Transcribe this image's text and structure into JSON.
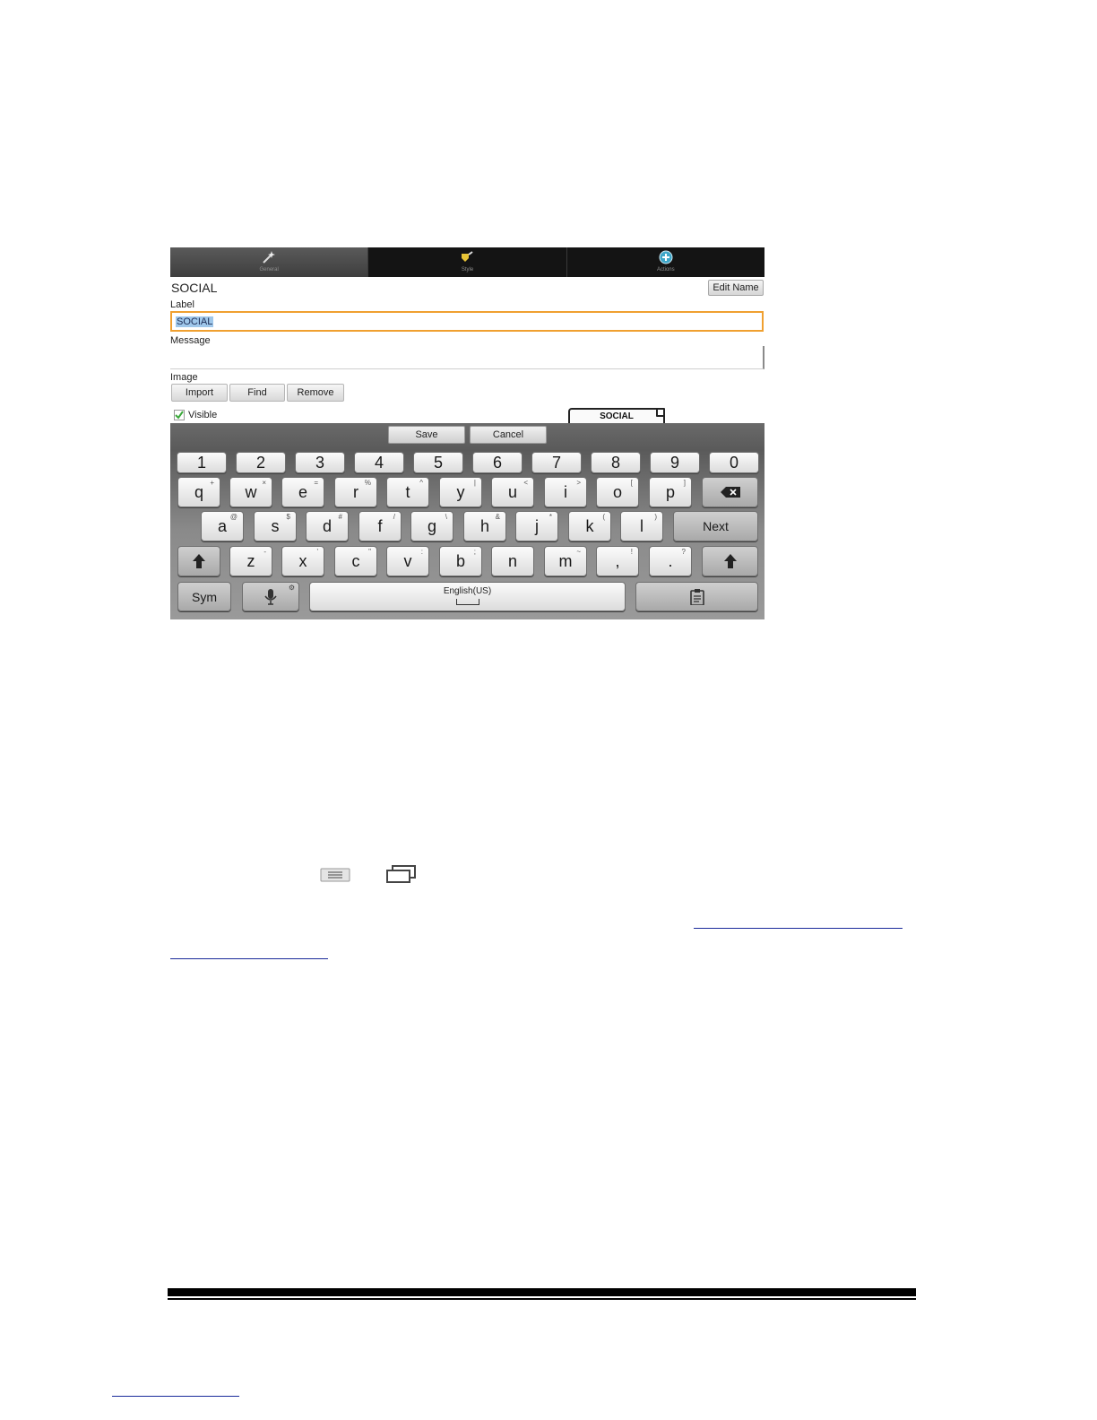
{
  "tabs": [
    {
      "label": "General",
      "icon": "wand-icon",
      "active": true
    },
    {
      "label": "Style",
      "icon": "paint-icon",
      "active": false
    },
    {
      "label": "Actions",
      "icon": "plus-circle-icon",
      "active": false
    }
  ],
  "form": {
    "button_name": "SOCIAL",
    "edit_name_label": "Edit Name",
    "label_caption": "Label",
    "label_value": "SOCIAL",
    "message_caption": "Message",
    "message_value": "",
    "image_caption": "Image",
    "import_label": "Import",
    "find_label": "Find",
    "remove_label": "Remove",
    "visible_label": "Visible",
    "visible_checked": true,
    "preview_text": "SOCIAL"
  },
  "actions": {
    "save_label": "Save",
    "cancel_label": "Cancel"
  },
  "keyboard": {
    "numbers": [
      "1",
      "2",
      "3",
      "4",
      "5",
      "6",
      "7",
      "8",
      "9",
      "0"
    ],
    "row1": [
      {
        "k": "q",
        "h": "+"
      },
      {
        "k": "w",
        "h": "×"
      },
      {
        "k": "e",
        "h": "="
      },
      {
        "k": "r",
        "h": "%"
      },
      {
        "k": "t",
        "h": "^"
      },
      {
        "k": "y",
        "h": "|"
      },
      {
        "k": "u",
        "h": "<"
      },
      {
        "k": "i",
        "h": ">"
      },
      {
        "k": "o",
        "h": "["
      },
      {
        "k": "p",
        "h": "]"
      }
    ],
    "row2": [
      {
        "k": "a",
        "h": "@"
      },
      {
        "k": "s",
        "h": "$"
      },
      {
        "k": "d",
        "h": "#"
      },
      {
        "k": "f",
        "h": "/"
      },
      {
        "k": "g",
        "h": "\\"
      },
      {
        "k": "h",
        "h": "&"
      },
      {
        "k": "j",
        "h": "*"
      },
      {
        "k": "k",
        "h": "("
      },
      {
        "k": "l",
        "h": ")"
      }
    ],
    "row3": [
      {
        "k": "z",
        "h": "-"
      },
      {
        "k": "x",
        "h": "'"
      },
      {
        "k": "c",
        "h": "\""
      },
      {
        "k": "v",
        "h": ":"
      },
      {
        "k": "b",
        "h": ";"
      },
      {
        "k": "n",
        "h": ""
      },
      {
        "k": "m",
        "h": "~"
      },
      {
        "k": ",",
        "h": "!"
      },
      {
        "k": ".",
        "h": "?"
      }
    ],
    "next_label": "Next",
    "sym_label": "Sym",
    "space_label": "English(US)"
  },
  "colors": {
    "accent": "#f0a030",
    "selection": "#9fc7ea",
    "link": "#1a2a9a"
  }
}
